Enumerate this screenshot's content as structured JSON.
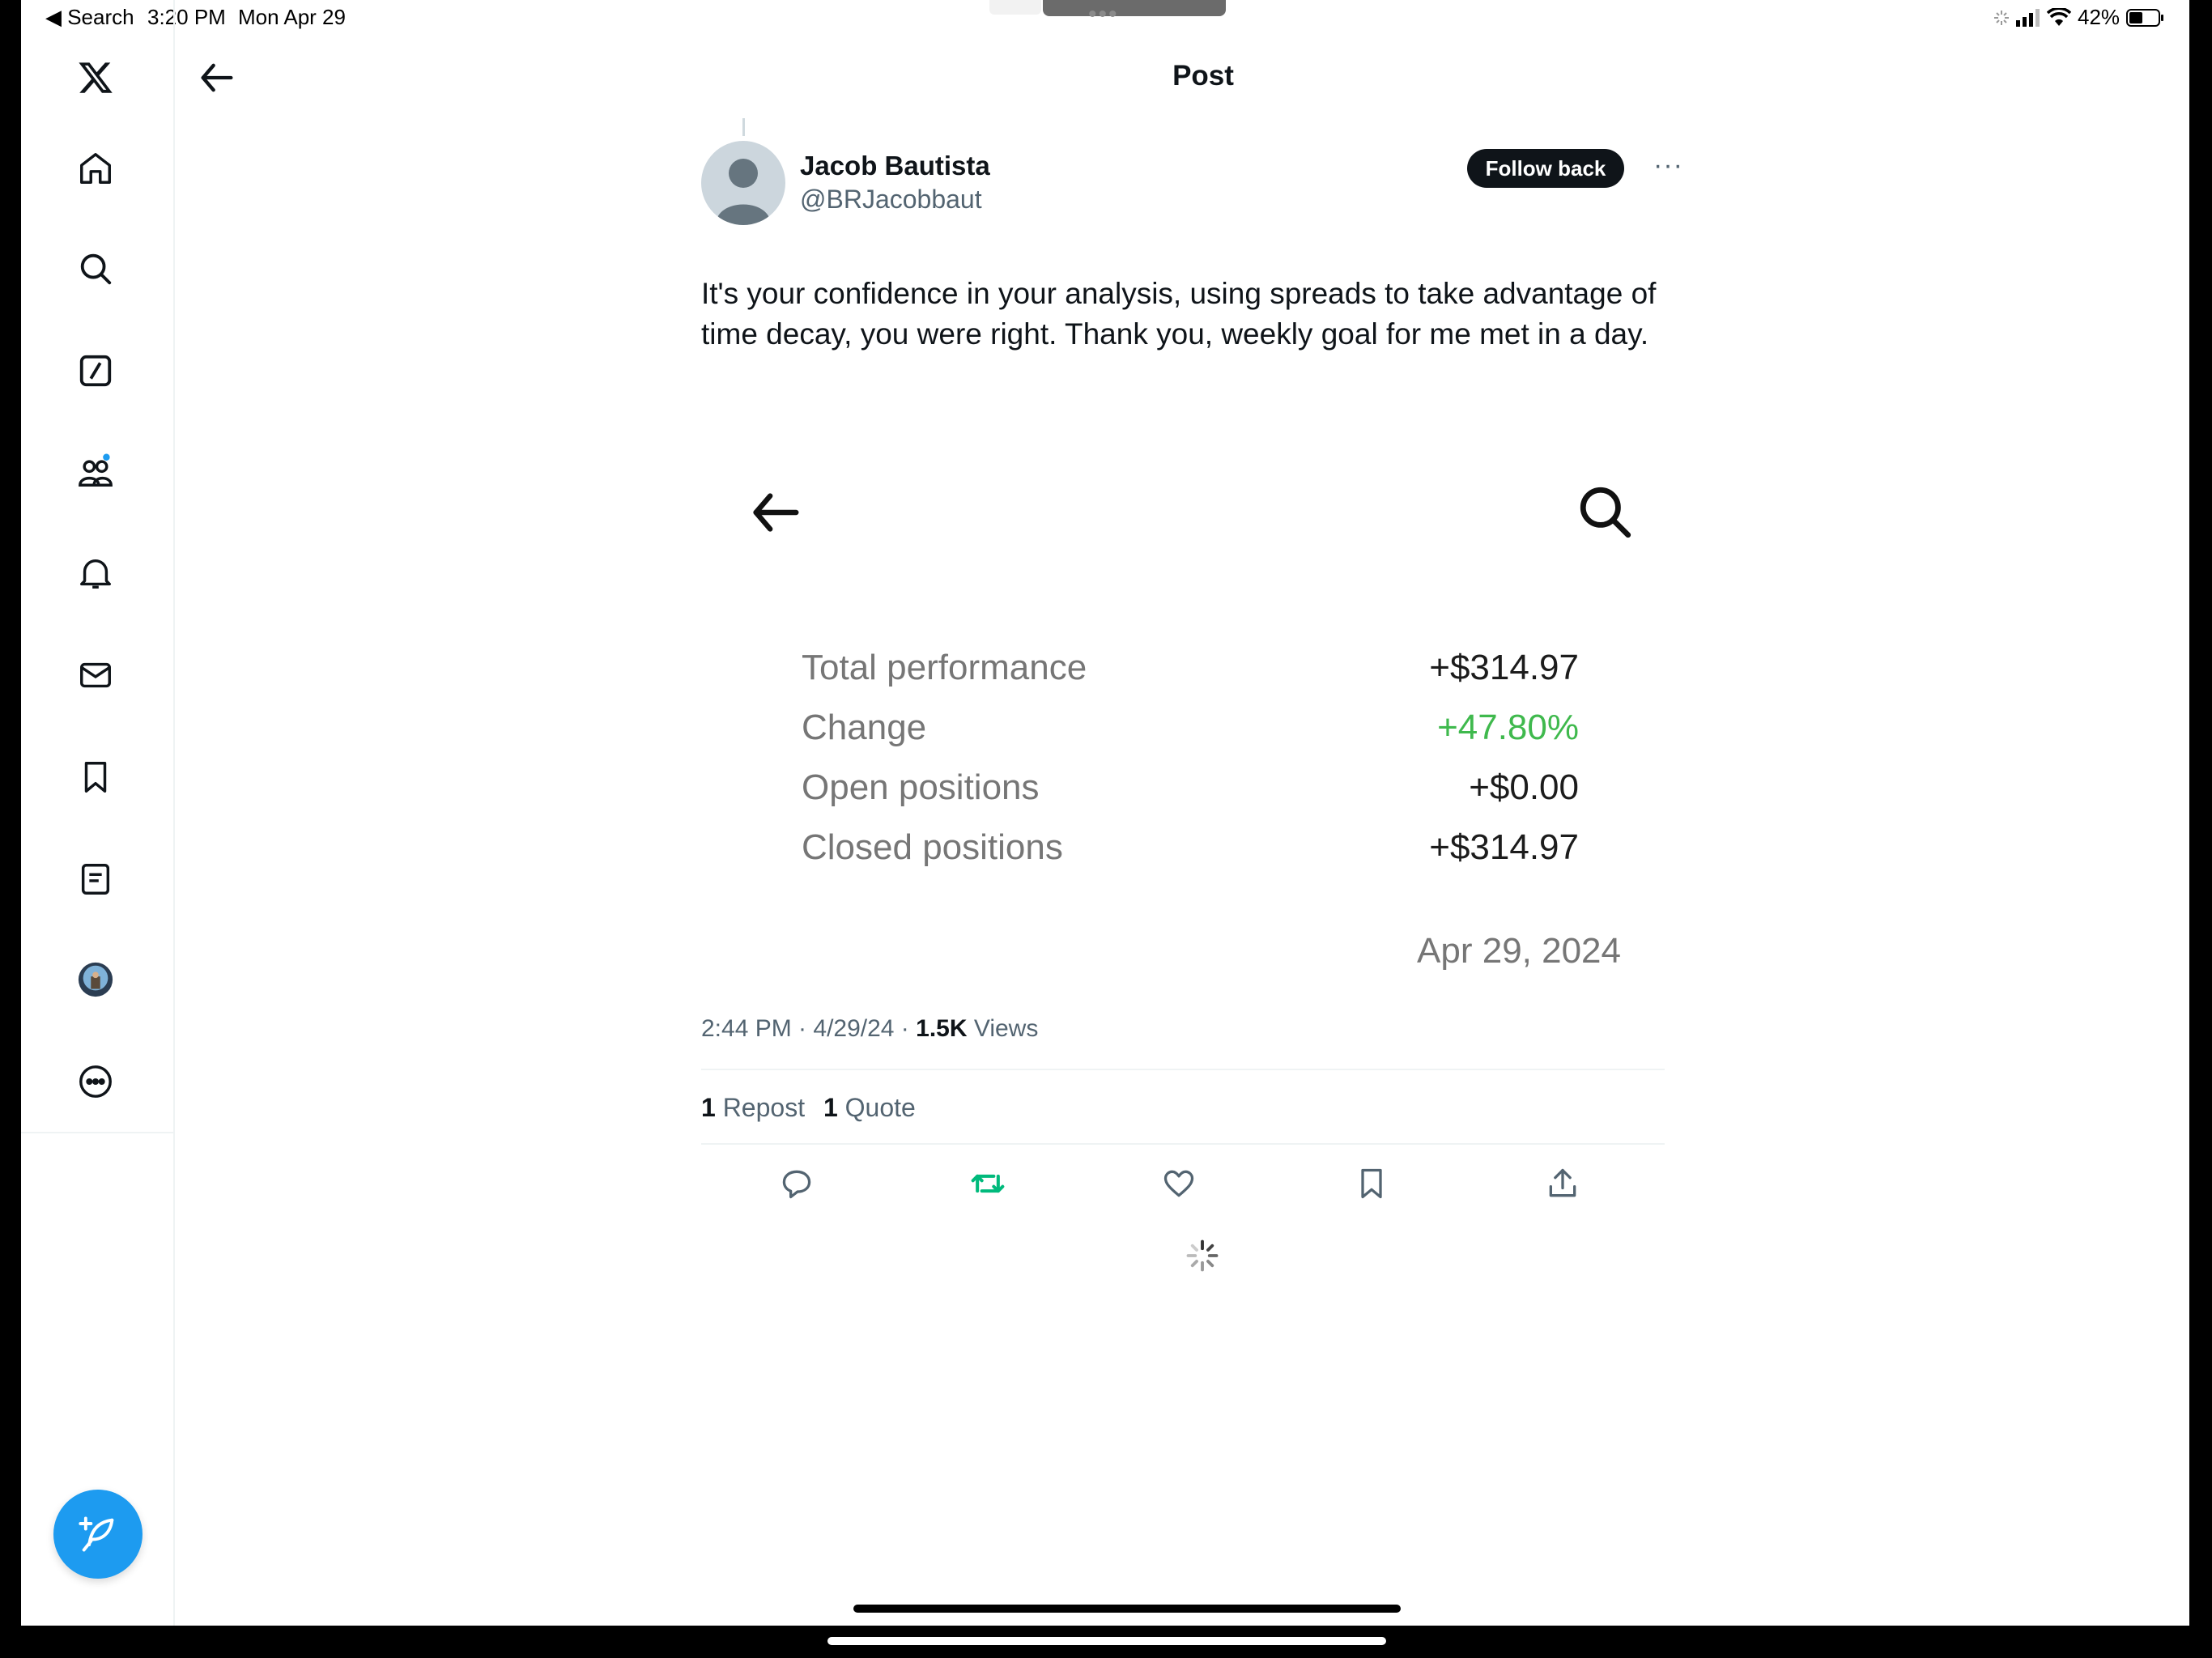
{
  "status_bar": {
    "back_app": "◀ Search",
    "time": "3:20 PM",
    "date": "Mon Apr 29",
    "battery": "42%"
  },
  "header": {
    "title": "Post"
  },
  "sidebar": {
    "items": [
      {
        "icon": "x-logo-icon"
      },
      {
        "icon": "home-icon"
      },
      {
        "icon": "search-icon"
      },
      {
        "icon": "grok-icon"
      },
      {
        "icon": "communities-icon"
      },
      {
        "icon": "notifications-icon"
      },
      {
        "icon": "messages-icon"
      },
      {
        "icon": "bookmarks-icon"
      },
      {
        "icon": "lists-icon"
      },
      {
        "icon": "profile-avatar"
      },
      {
        "icon": "more-icon"
      }
    ],
    "compose_icon": "compose-feather-icon",
    "accent": "#1d9bf0"
  },
  "post": {
    "author_name": "Jacob Bautista",
    "author_handle": "@BRJacobbaut",
    "follow_label": "Follow back",
    "text": "It's your confidence in your analysis, using spreads to take advantage of time decay, you were right. Thank you, weekly goal for me met in a day.",
    "embed": {
      "rows": [
        {
          "label": "Total performance",
          "value": "+$314.97"
        },
        {
          "label": "Change",
          "value": "+47.80%"
        },
        {
          "label": "Open positions",
          "value": "+$0.00"
        },
        {
          "label": "Closed positions",
          "value": "+$314.97"
        }
      ],
      "date": "Apr 29, 2024",
      "positive_color": "#3fb94d"
    },
    "meta_time": "2:44 PM · 4/29/24 · ",
    "views_count": "1.5K",
    "views_label": " Views",
    "repost_count": "1",
    "repost_label": "Repost",
    "quote_count": "1",
    "quote_label": "Quote",
    "repost_active_color": "#00ba7c"
  }
}
